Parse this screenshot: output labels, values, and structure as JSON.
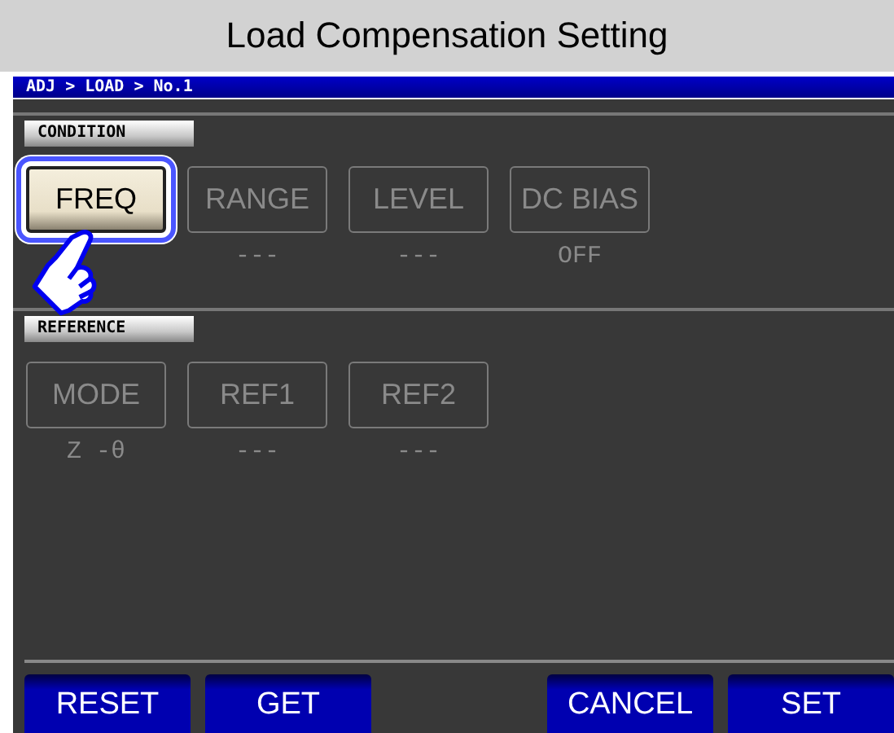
{
  "window": {
    "title": "Load Compensation Setting"
  },
  "breadcrumb": "ADJ > LOAD > No.1",
  "sections": [
    {
      "label": "CONDITION",
      "keys": [
        {
          "label": "FREQ",
          "disabled": false,
          "selected": true
        },
        {
          "label": "RANGE",
          "disabled": true,
          "selected": false,
          "value": "---"
        },
        {
          "label": "LEVEL",
          "disabled": true,
          "selected": false,
          "value": "---"
        },
        {
          "label": "DC BIAS",
          "disabled": true,
          "selected": false,
          "value": "OFF"
        }
      ]
    },
    {
      "label": "REFERENCE",
      "keys": [
        {
          "label": "MODE",
          "disabled": true,
          "selected": false,
          "value": "Z -θ"
        },
        {
          "label": "REF1",
          "disabled": true,
          "selected": false,
          "value": "---"
        },
        {
          "label": "REF2",
          "disabled": true,
          "selected": false,
          "value": "---"
        }
      ]
    }
  ],
  "footer_left": [
    {
      "label": "RESET"
    },
    {
      "label": "GET"
    }
  ],
  "footer_right": [
    {
      "label": "CANCEL"
    },
    {
      "label": "SET"
    }
  ]
}
